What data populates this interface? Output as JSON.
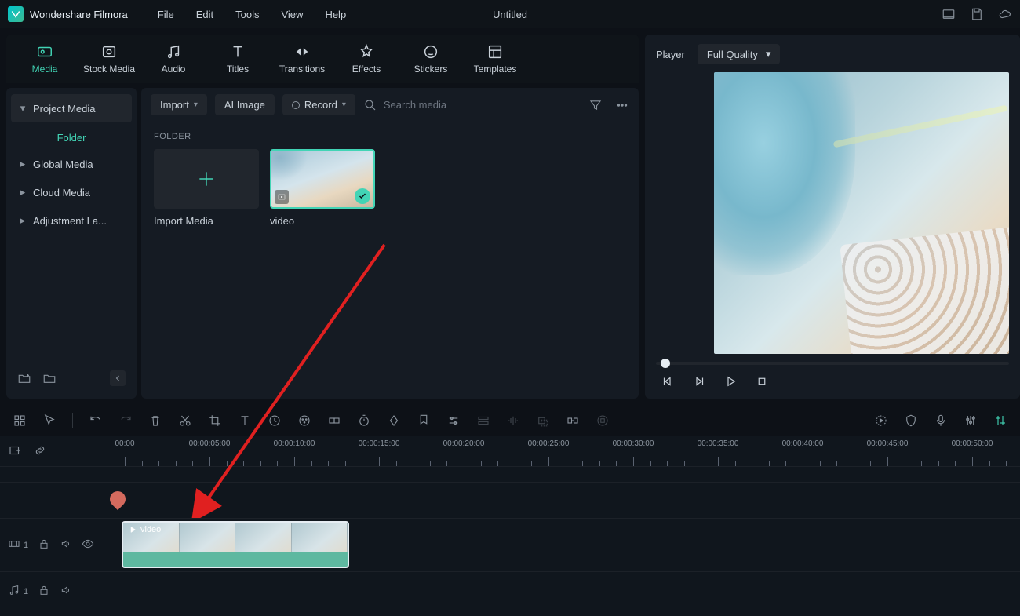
{
  "app": {
    "title": "Wondershare Filmora",
    "doc_title": "Untitled"
  },
  "menu": [
    "File",
    "Edit",
    "Tools",
    "View",
    "Help"
  ],
  "top_tabs": [
    {
      "label": "Media",
      "icon": "media",
      "active": true
    },
    {
      "label": "Stock Media",
      "icon": "stock"
    },
    {
      "label": "Audio",
      "icon": "audio"
    },
    {
      "label": "Titles",
      "icon": "titles"
    },
    {
      "label": "Transitions",
      "icon": "transitions"
    },
    {
      "label": "Effects",
      "icon": "effects"
    },
    {
      "label": "Stickers",
      "icon": "stickers"
    },
    {
      "label": "Templates",
      "icon": "templates"
    }
  ],
  "sidebar": {
    "items": [
      {
        "label": "Project Media",
        "active": true
      },
      {
        "label": "Global Media"
      },
      {
        "label": "Cloud Media"
      },
      {
        "label": "Adjustment La..."
      }
    ],
    "folder_label": "Folder"
  },
  "toolbar": {
    "import": "Import",
    "ai_image": "AI Image",
    "record": "Record",
    "search_placeholder": "Search media"
  },
  "media": {
    "section": "FOLDER",
    "import_label": "Import Media",
    "items": [
      {
        "name": "video"
      }
    ]
  },
  "player": {
    "label": "Player",
    "quality": "Full Quality"
  },
  "timeline": {
    "labels": [
      "00:00",
      "00:00:05:00",
      "00:00:10:00",
      "00:00:15:00",
      "00:00:20:00",
      "00:00:25:00",
      "00:00:30:00",
      "00:00:35:00",
      "00:00:40:00",
      "00:00:45:00",
      "00:00:50:00"
    ],
    "tracks": {
      "video": "1",
      "audio": "1"
    },
    "clip_label": "video"
  }
}
